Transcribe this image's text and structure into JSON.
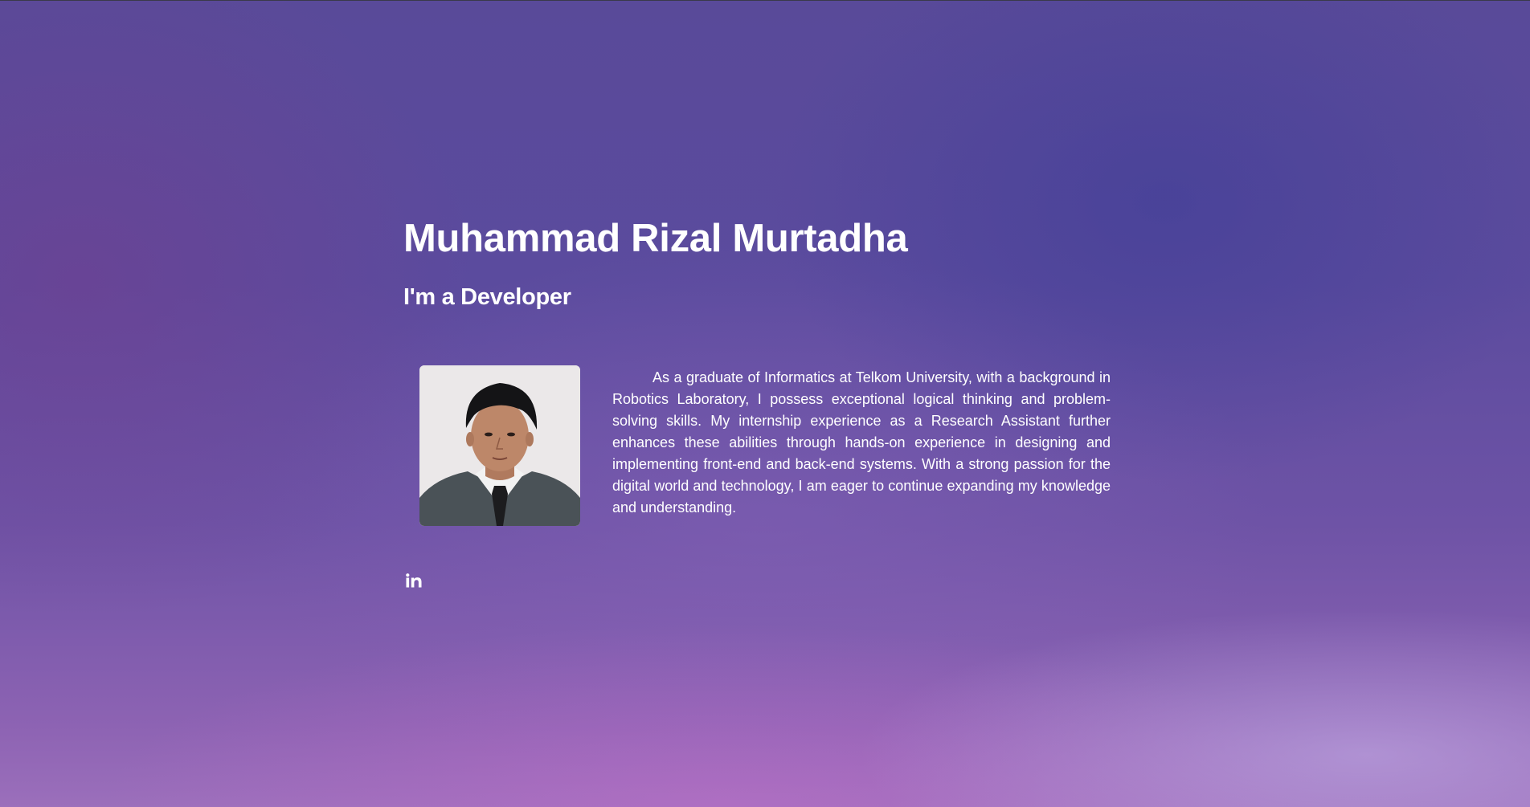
{
  "profile": {
    "name": "Muhammad Rizal Murtadha",
    "tagline": "I'm a Developer",
    "bio": "As a graduate of Informatics at Telkom University, with a background in Robotics Laboratory, I possess exceptional logical thinking and problem-solving skills. My internship experience as a Research Assistant further enhances these abilities through hands-on experience in designing and implementing front-end and back-end systems. With a strong passion for the digital world and technology, I am eager to continue expanding my knowledge and understanding."
  },
  "social": {
    "icons": [
      "linkedin-icon"
    ]
  },
  "colors": {
    "text": "#ffffff",
    "background_top": "#594a99",
    "background_bottom": "#9b6fbb"
  }
}
